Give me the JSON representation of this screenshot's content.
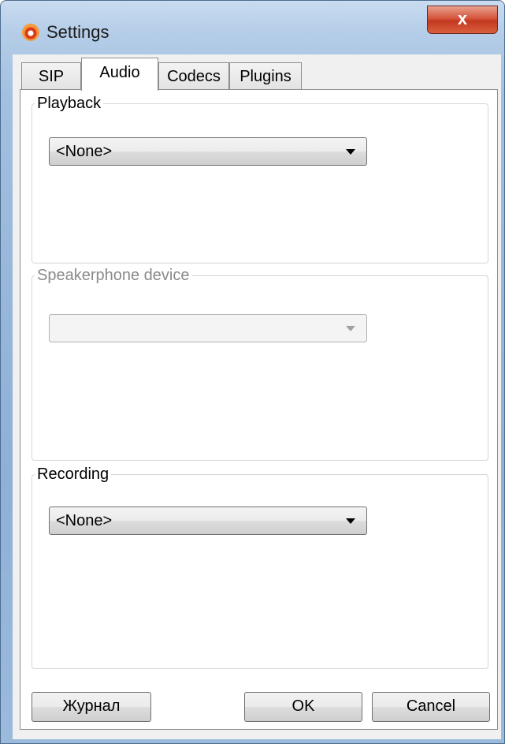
{
  "window": {
    "title": "Settings"
  },
  "titlebar": {
    "close_glyph": "x"
  },
  "tabs": [
    {
      "label": "SIP"
    },
    {
      "label": "Audio",
      "selected": true
    },
    {
      "label": "Codecs"
    },
    {
      "label": "Plugins"
    }
  ],
  "playback": {
    "legend": "Playback",
    "value": "<None>"
  },
  "speakerphone": {
    "legend": "Speakerphone device",
    "value": "",
    "enabled": false
  },
  "recording": {
    "legend": "Recording",
    "value": "<None>"
  },
  "buttons": {
    "log": "Журнал",
    "ok": "OK",
    "cancel": "Cancel"
  },
  "colors": {
    "title_bar": "#b5cde8",
    "close_button": "#c3391f",
    "dialog_bg": "#f0f0f0"
  }
}
